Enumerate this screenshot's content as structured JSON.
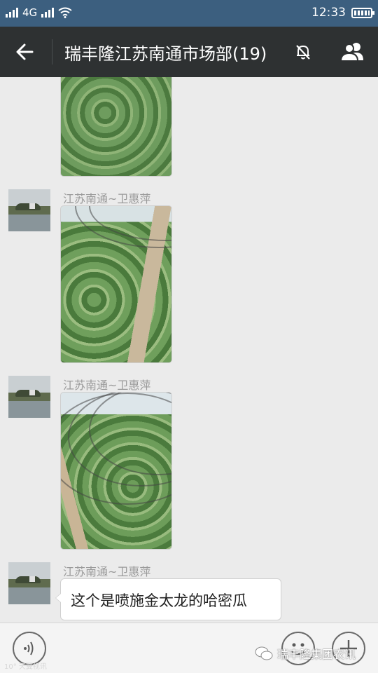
{
  "status_bar": {
    "carrier_left": "4G",
    "time": "12:33"
  },
  "nav": {
    "title": "瑞丰隆江苏南通市场部(19)"
  },
  "messages": [
    {
      "type": "image",
      "photo": "melon-seedlings-ground",
      "sender": ""
    },
    {
      "type": "image",
      "photo": "melon-greenhouse-row",
      "sender": "江苏南通~卫惠萍"
    },
    {
      "type": "image",
      "photo": "melon-greenhouse-tunnel",
      "sender": "江苏南通~卫惠萍"
    },
    {
      "type": "text",
      "sender": "江苏南通~卫惠萍",
      "text": "这个是喷施金太龙的哈密瓜"
    }
  ],
  "watermark": {
    "left": "10° 天翼视讯",
    "right": "瑞丰隆集团农讯"
  },
  "icons": {
    "back": "back-arrow-icon",
    "mute": "mute-bell-icon",
    "group": "group-members-icon",
    "voice": "voice-icon",
    "emoji": "emoji-icon",
    "plus": "plus-icon"
  }
}
